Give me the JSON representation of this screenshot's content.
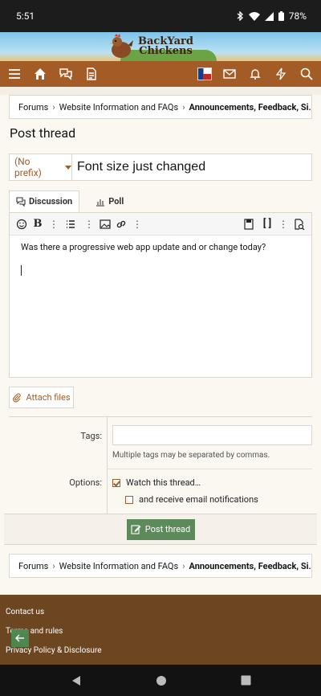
{
  "status_bar": {
    "time": "5:51",
    "battery": "78%",
    "icons": [
      "bluetooth-icon",
      "wifi-icon",
      "signal-icon",
      "battery-icon"
    ]
  },
  "banner": {
    "logo_line1": "BackYard",
    "logo_line2": "Chickens"
  },
  "nav": {
    "left_icons": [
      "menu-icon",
      "home-icon",
      "forum-icon",
      "document-icon"
    ],
    "right_icons": [
      "avatar-flag",
      "mail-icon",
      "bell-icon",
      "lightning-icon",
      "search-icon"
    ]
  },
  "breadcrumb": {
    "items": [
      "Forums",
      "Website Information and FAQs",
      "Announcements, Feedback, Si..."
    ]
  },
  "page_title": "Post thread",
  "thread_form": {
    "prefix_label": "(No prefix)",
    "title_value": "Font size just changed",
    "tabs": [
      "Discussion",
      "Poll"
    ],
    "body_text": "Was there a progressive web app update and or change today?",
    "attach_label": "Attach files",
    "tags_label": "Tags:",
    "tags_value": "",
    "tags_hint": "Multiple tags may be separated by commas.",
    "options_label": "Options:",
    "watch_label": "Watch this thread…",
    "watch_checked": true,
    "email_label": "and receive email notifications",
    "email_checked": false,
    "submit_label": "Post thread"
  },
  "footer": {
    "links": [
      "Contact us",
      "Terms and rules",
      "Privacy Policy & Disclosure"
    ]
  },
  "colors": {
    "brand_brown": "#a35c25",
    "footer_brown": "#6b4621",
    "submit_green": "#5c8a5a"
  }
}
